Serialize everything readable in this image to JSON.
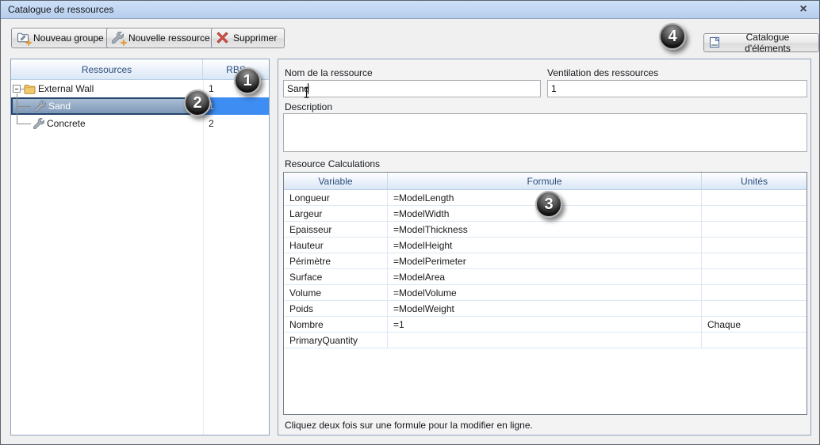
{
  "window": {
    "title": "Catalogue de ressources",
    "close_glyph": "×"
  },
  "toolbar": {
    "new_group_label": "Nouveau groupe",
    "new_resource_label": "Nouvelle ressource",
    "delete_label": "Supprimer",
    "element_catalog_label": "Catalogue d'éléments"
  },
  "tree": {
    "columns": [
      "Ressources",
      "RBS"
    ],
    "rows": [
      {
        "label": "External Wall",
        "rbs": "1",
        "type": "group",
        "indent": 16,
        "selected": false,
        "expanded": true
      },
      {
        "label": "Sand",
        "rbs": "1",
        "type": "resource",
        "indent": 28,
        "selected": true
      },
      {
        "label": "Concrete",
        "rbs": "2",
        "type": "resource",
        "indent": 28,
        "selected": false
      }
    ]
  },
  "form": {
    "name_label": "Nom de la ressource",
    "name_value": "Sand",
    "ventilation_label": "Ventilation des ressources",
    "ventilation_value": "1",
    "description_label": "Description",
    "description_value": "",
    "calculations_label": "Resource Calculations"
  },
  "calc_table": {
    "columns": [
      "Variable",
      "Formule",
      "Unités"
    ],
    "rows": [
      {
        "variable": "Longueur",
        "formula": "=ModelLength",
        "units": ""
      },
      {
        "variable": "Largeur",
        "formula": "=ModelWidth",
        "units": ""
      },
      {
        "variable": "Epaisseur",
        "formula": "=ModelThickness",
        "units": ""
      },
      {
        "variable": "Hauteur",
        "formula": "=ModelHeight",
        "units": ""
      },
      {
        "variable": "Périmètre",
        "formula": "=ModelPerimeter",
        "units": ""
      },
      {
        "variable": "Surface",
        "formula": "=ModelArea",
        "units": ""
      },
      {
        "variable": "Volume",
        "formula": "=ModelVolume",
        "units": ""
      },
      {
        "variable": "Poids",
        "formula": "=ModelWeight",
        "units": ""
      },
      {
        "variable": "Nombre",
        "formula": "=1",
        "units": "Chaque"
      },
      {
        "variable": "PrimaryQuantity",
        "formula": "",
        "units": ""
      }
    ],
    "hint": "Cliquez deux fois sur une formule pour la modifier en ligne."
  },
  "badges": [
    "1",
    "2",
    "3",
    "4"
  ],
  "colors": {
    "titlebar": "#c3d6f0",
    "selection_fill": "#8aa0bd",
    "selection_border": "#24456b",
    "rbs_selected": "#3d8df3",
    "header_text": "#2b4d7e",
    "grid_line": "#dce8f5"
  }
}
